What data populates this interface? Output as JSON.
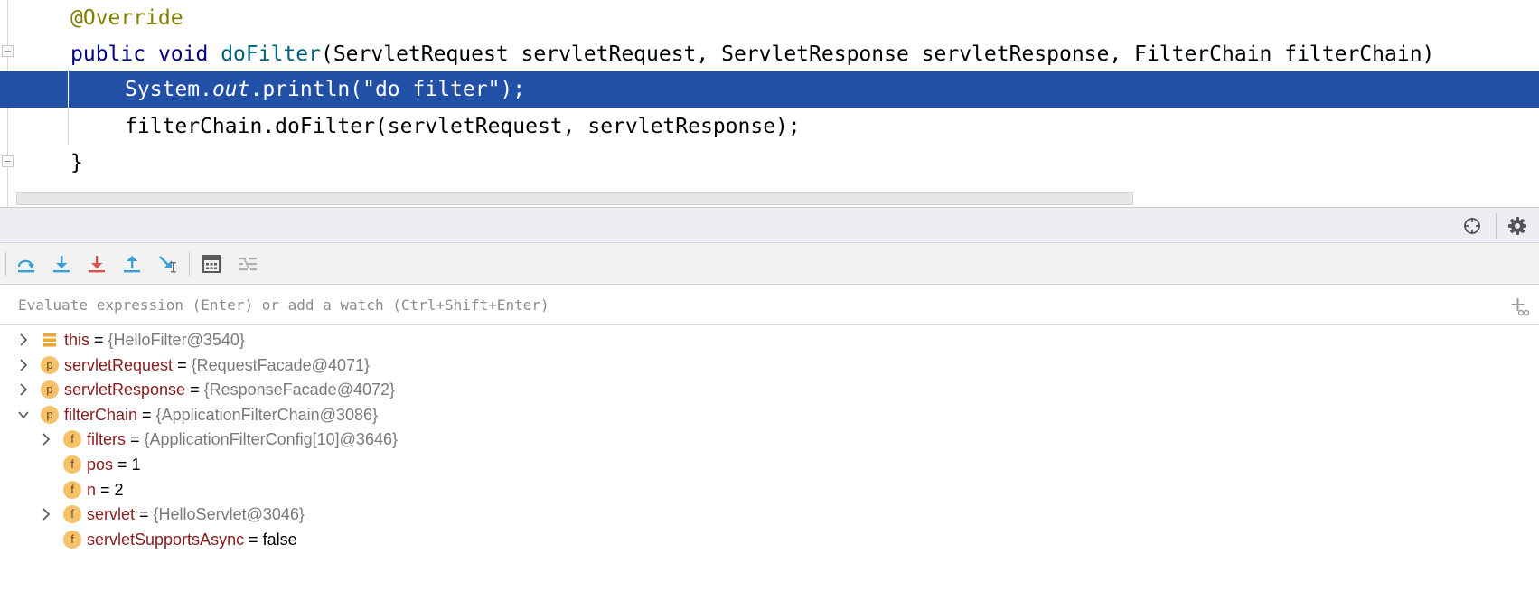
{
  "editor": {
    "lines": [
      {
        "segments": [
          {
            "text": "@Override",
            "style": "annotation"
          }
        ]
      },
      {
        "segments": [
          {
            "text": "public",
            "style": "keyword"
          },
          {
            "text": " ",
            "style": "plain"
          },
          {
            "text": "void",
            "style": "keyword"
          },
          {
            "text": " ",
            "style": "plain"
          },
          {
            "text": "doFilter",
            "style": "method-decl"
          },
          {
            "text": "(ServletRequest servletRequest, ServletResponse servletResponse, FilterChain filterChain)",
            "style": "plain"
          }
        ]
      },
      {
        "selected": true,
        "segments": [
          {
            "text": "System.",
            "style": "plain"
          },
          {
            "text": "out",
            "style": "italic"
          },
          {
            "text": ".println(\"do filter\");",
            "style": "plain"
          }
        ]
      },
      {
        "segments": [
          {
            "text": "filterChain.doFilter(servletRequest, servletResponse);",
            "style": "plain"
          }
        ]
      },
      {
        "segments": [
          {
            "text": "}",
            "style": "plain"
          }
        ]
      }
    ]
  },
  "debug_header": {
    "buttons": [
      {
        "name": "restore-layout-button",
        "icon": "crosshair-icon"
      },
      {
        "name": "settings-button",
        "icon": "gear-icon"
      }
    ]
  },
  "debug_toolbar": {
    "buttons": [
      {
        "name": "step-over-button",
        "icon": "step-over-icon",
        "color": "#389fd6"
      },
      {
        "name": "step-into-button",
        "icon": "step-into-icon",
        "color": "#389fd6"
      },
      {
        "name": "force-step-into-button",
        "icon": "force-step-into-icon",
        "color": "#d9534f"
      },
      {
        "name": "step-out-button",
        "icon": "step-out-icon",
        "color": "#389fd6"
      },
      {
        "name": "run-to-cursor-button",
        "icon": "run-to-cursor-icon",
        "color": "#389fd6"
      },
      {
        "name": "evaluate-expression-button",
        "icon": "calculator-icon",
        "color": "#5a5a5a"
      },
      {
        "name": "trace-current-stream-button",
        "icon": "stream-trace-icon",
        "color": "#b0b0b0"
      }
    ]
  },
  "evaluate": {
    "placeholder": "Evaluate expression (Enter) or add a watch (Ctrl+Shift+Enter)",
    "value": ""
  },
  "variables": [
    {
      "depth": 0,
      "expander": "collapsed",
      "icon": "fields-icon",
      "badge": "",
      "name": "this",
      "value": "{HelloFilter@3540}",
      "value_kind": "object"
    },
    {
      "depth": 0,
      "expander": "collapsed",
      "icon": "parameter-icon",
      "badge": "p",
      "name": "servletRequest",
      "value": "{RequestFacade@4071}",
      "value_kind": "object"
    },
    {
      "depth": 0,
      "expander": "collapsed",
      "icon": "parameter-icon",
      "badge": "p",
      "name": "servletResponse",
      "value": "{ResponseFacade@4072}",
      "value_kind": "object"
    },
    {
      "depth": 0,
      "expander": "expanded",
      "icon": "parameter-icon",
      "badge": "p",
      "name": "filterChain",
      "value": "{ApplicationFilterChain@3086}",
      "value_kind": "object"
    },
    {
      "depth": 1,
      "expander": "collapsed",
      "icon": "field-icon",
      "badge": "f",
      "name": "filters",
      "value": "{ApplicationFilterConfig[10]@3646}",
      "value_kind": "object"
    },
    {
      "depth": 1,
      "expander": "none",
      "icon": "field-icon",
      "badge": "f",
      "name": "pos",
      "value": "1",
      "value_kind": "primitive"
    },
    {
      "depth": 1,
      "expander": "none",
      "icon": "field-icon",
      "badge": "f",
      "name": "n",
      "value": "2",
      "value_kind": "primitive"
    },
    {
      "depth": 1,
      "expander": "collapsed",
      "icon": "field-icon",
      "badge": "f",
      "name": "servlet",
      "value": "{HelloServlet@3046}",
      "value_kind": "object"
    },
    {
      "depth": 1,
      "expander": "none",
      "icon": "field-icon",
      "badge": "f",
      "name": "servletSupportsAsync",
      "value": "false",
      "value_kind": "primitive"
    }
  ],
  "colors": {
    "selection": "#2150a6",
    "variable_name": "#871d1d",
    "object_value": "#7a7a7a",
    "badge": "#f5c26b",
    "annotation": "#808000",
    "keyword": "#000080"
  }
}
